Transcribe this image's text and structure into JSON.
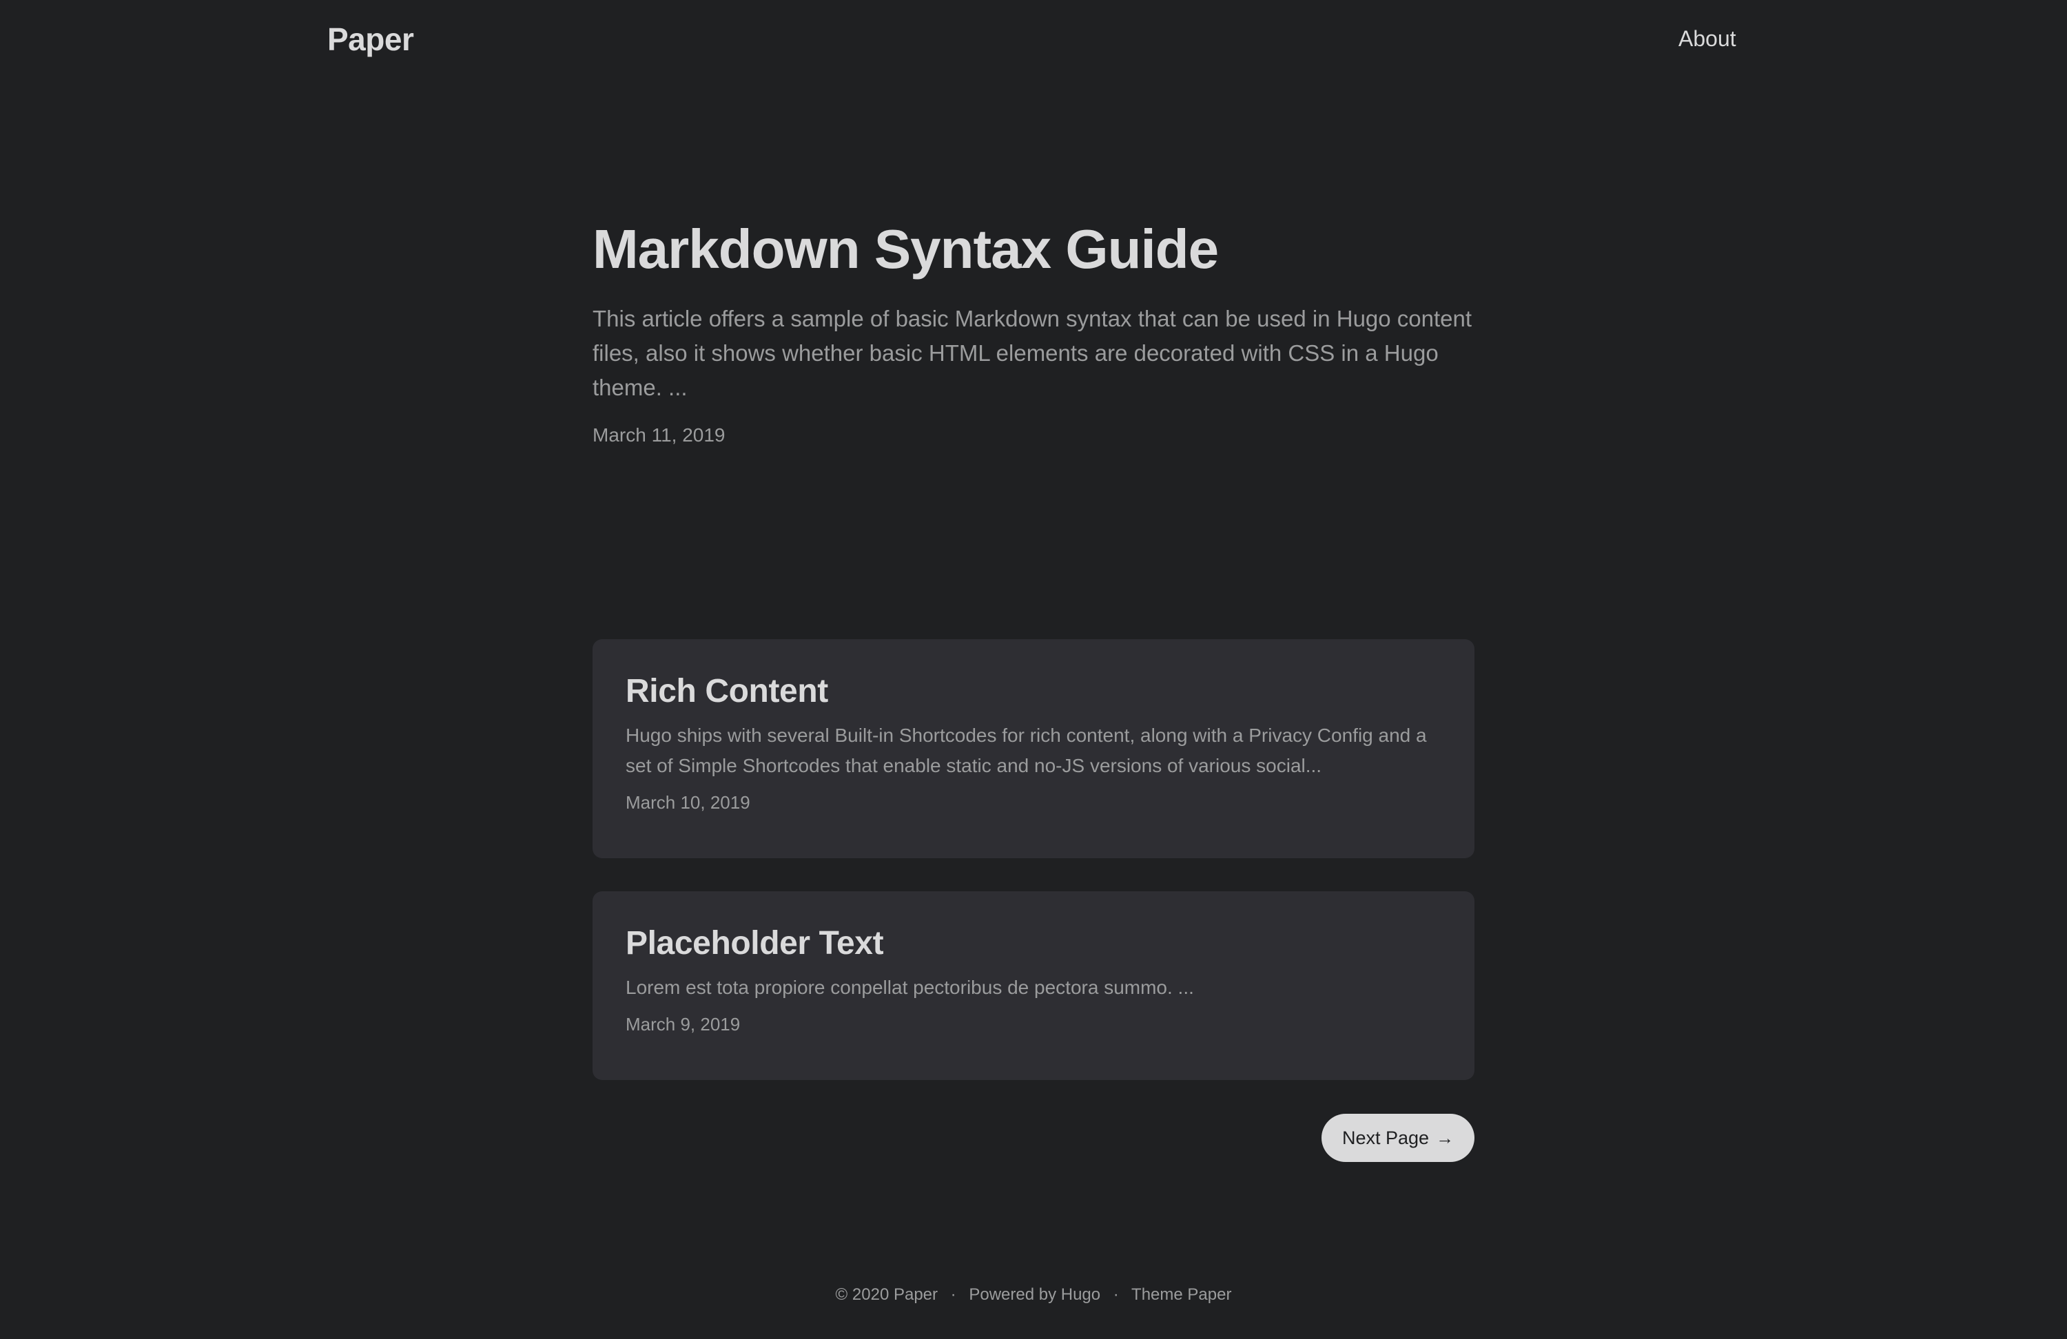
{
  "header": {
    "logo": "Paper",
    "nav": {
      "about": "About"
    }
  },
  "home_entry": {
    "title": "Markdown Syntax Guide",
    "excerpt": "This article offers a sample of basic Markdown syntax that can be used in Hugo content files, also it shows whether basic HTML elements are decorated with CSS in a Hugo theme. ...",
    "date": "March 11, 2019"
  },
  "posts": [
    {
      "title": "Rich Content",
      "excerpt": "Hugo ships with several Built-in Shortcodes for rich content, along with a Privacy Config and a set of Simple Shortcodes that enable static and no-JS versions of various social...",
      "date": "March 10, 2019"
    },
    {
      "title": "Placeholder Text",
      "excerpt": "Lorem est tota propiore conpellat pectoribus de pectora summo. ...",
      "date": "March 9, 2019"
    }
  ],
  "pagination": {
    "next_label": "Next Page",
    "next_icon": "arrow-right-icon",
    "arrow_glyph": "→"
  },
  "footer": {
    "copyright": "© 2020 Paper",
    "separator": "·",
    "powered_by": "Powered by Hugo",
    "theme": "Theme Paper"
  },
  "colors": {
    "background": "#1f2022",
    "card": "#2e2e33",
    "text_primary": "#dadadb",
    "text_secondary": "#9b9c9d",
    "button_bg": "#dadadb"
  }
}
